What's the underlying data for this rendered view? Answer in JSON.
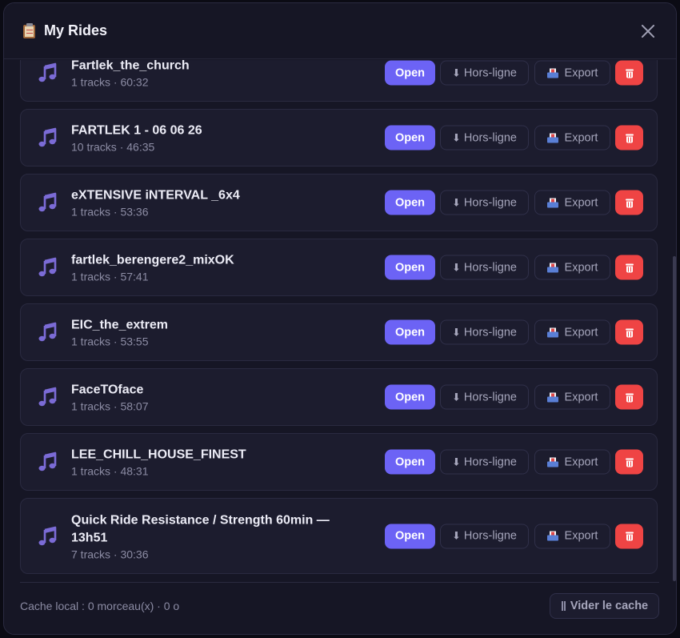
{
  "header": {
    "title_icon": "clipboard-icon",
    "title": "My Rides",
    "close_icon": "close-icon"
  },
  "rides": [
    {
      "name": "Fartlek_the_church",
      "meta": "1 tracks · 60:32"
    },
    {
      "name": "FARTLEK 1 - 06 06 26",
      "meta": "10 tracks · 46:35"
    },
    {
      "name": "eXTENSIVE iNTERVAL _6x4",
      "meta": "1 tracks · 53:36"
    },
    {
      "name": "fartlek_berengere2_mixOK",
      "meta": "1 tracks · 57:41"
    },
    {
      "name": "EIC_the_extrem",
      "meta": "1 tracks · 53:55"
    },
    {
      "name": "FaceTOface",
      "meta": "1 tracks · 58:07"
    },
    {
      "name": "LEE_CHILL_HOUSE_FINEST",
      "meta": "1 tracks · 48:31"
    },
    {
      "name": "Quick Ride Resistance / Strength 60min — 13h51",
      "meta": "7 tracks · 30:36"
    }
  ],
  "actions": {
    "open_label": "Open",
    "offline_glyph": "⬇",
    "offline_label": "Hors-ligne",
    "export_label": "Export",
    "export_icon": "outbox-icon",
    "delete_icon": "trash-icon"
  },
  "footer": {
    "cache_status": "Cache local : 0 morceau(x) · 0 o",
    "clear_cache_label": "Vider le cache"
  },
  "colors": {
    "accent": "#6c63f5",
    "danger": "#ef4444",
    "background": "#161625",
    "card": "#1c1c2e"
  }
}
